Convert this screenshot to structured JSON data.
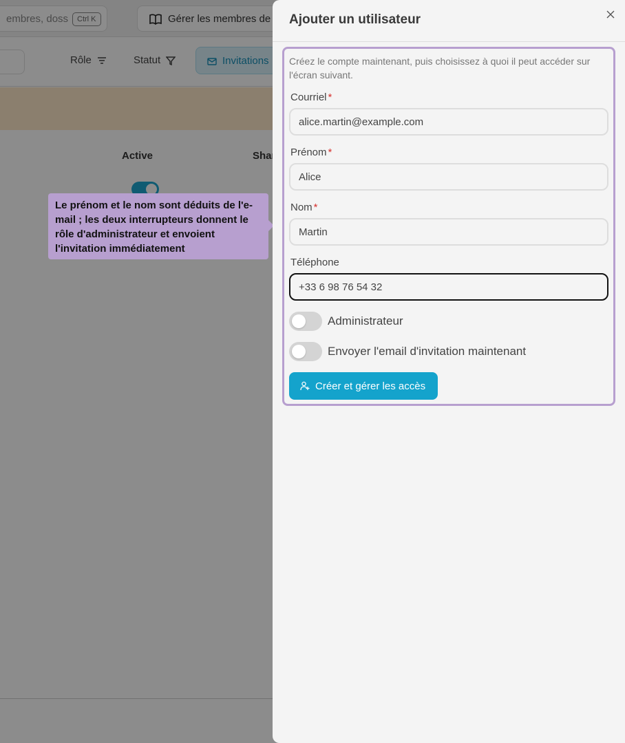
{
  "background": {
    "search_placeholder": "embres, doss",
    "search_shortcut": "Ctrl K",
    "manage_members_label": "Gérer les membres de",
    "filters": {
      "role": "Rôle",
      "status": "Statut",
      "invitations": "Invitations"
    },
    "columns": {
      "active": "Active",
      "shared": "Shar"
    }
  },
  "tooltip": {
    "text": "Le prénom et le nom sont déduits de l'e-mail ; les deux interrupteurs donnent le rôle d'administrateur et envoient l'invitation immédiatement"
  },
  "panel": {
    "title": "Ajouter un utilisateur",
    "intro": "Créez le compte maintenant, puis choisissez à quoi il peut accéder sur l'écran suivant.",
    "fields": {
      "email": {
        "label": "Courriel",
        "required_mark": "*",
        "value": "alice.martin@example.com"
      },
      "first_name": {
        "label": "Prénom",
        "required_mark": "*",
        "value": "Alice"
      },
      "last_name": {
        "label": "Nom",
        "required_mark": "*",
        "value": "Martin"
      },
      "phone": {
        "label": "Téléphone",
        "value": "+33 6 98 76 54 32"
      }
    },
    "toggles": {
      "admin": {
        "label": "Administrateur",
        "on": false
      },
      "send_invite": {
        "label": "Envoyer l'email d'invitation maintenant",
        "on": false
      }
    },
    "create_button_label": "Créer et gérer les accès"
  },
  "colors": {
    "accent": "#14a3cc",
    "tooltip": "#b79fcf",
    "required": "#d6322f"
  }
}
